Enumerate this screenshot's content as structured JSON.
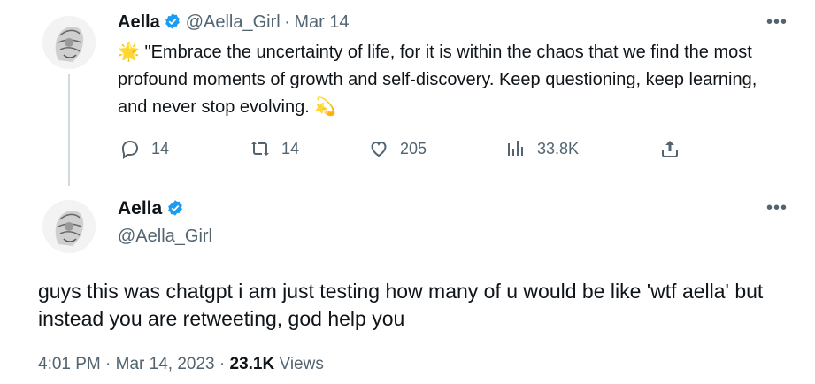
{
  "tweet1": {
    "name": "Aella",
    "handle": "@Aella_Girl",
    "separator": "·",
    "date": "Mar 14",
    "more": "•••",
    "emoji_start": "🌟",
    "text": "\"Embrace the uncertainty of life, for it is within the chaos that we find the most profound moments of growth and self-discovery. Keep questioning, keep learning, and never stop evolving.",
    "emoji_end": "💫",
    "replies": "14",
    "retweets": "14",
    "likes": "205",
    "views": "33.8K"
  },
  "tweet2": {
    "name": "Aella",
    "handle": "@Aella_Girl",
    "more": "•••",
    "text": "guys this was chatgpt i am just testing how many of u would be like 'wtf aella' but instead you are retweeting, god help you",
    "time": "4:01 PM",
    "dot": "·",
    "date": "Mar 14, 2023",
    "dot2": "·",
    "views_count": "23.1K",
    "views_label": "Views"
  },
  "colors": {
    "verified": "#1d9bf0",
    "muted": "#536471",
    "text": "#0f1419",
    "line": "#cfd9de"
  }
}
